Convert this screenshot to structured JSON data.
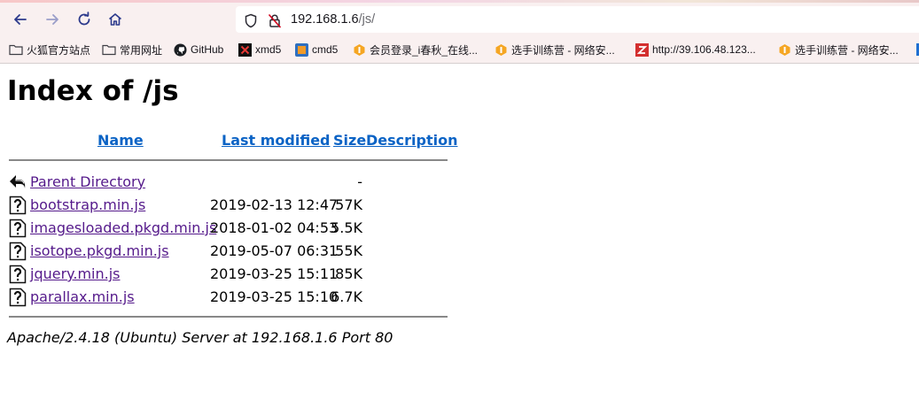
{
  "browser": {
    "url_host": "192.168.1.6",
    "url_path": "/js/"
  },
  "bookmarks": [
    {
      "label": "火狐官方站点",
      "icon": "folder-icon"
    },
    {
      "label": "常用网址",
      "icon": "folder-icon"
    },
    {
      "label": "GitHub",
      "icon": "github-icon"
    },
    {
      "label": "xmd5",
      "icon": "xmd5-icon"
    },
    {
      "label": "cmd5",
      "icon": "cmd5-icon"
    },
    {
      "label": "会员登录_i春秋_在线...",
      "icon": "ichunqiu-icon"
    },
    {
      "label": "选手训练营 - 网络安...",
      "icon": "ichunqiu-icon"
    },
    {
      "label": "http://39.106.48.123...",
      "icon": "z-icon"
    },
    {
      "label": "选手训练营 - 网络安...",
      "icon": "ichunqiu-icon"
    }
  ],
  "page": {
    "title": "Index of /js",
    "columns": {
      "name": "Name",
      "last_modified": "Last modified",
      "size": "Size",
      "description": "Description"
    },
    "rows": [
      {
        "name": "Parent Directory",
        "date": "",
        "size": "-",
        "icon": "back-arrow-icon"
      },
      {
        "name": "bootstrap.min.js",
        "date": "2019-02-13 12:47",
        "size": "57K",
        "icon": "unknown-file-icon"
      },
      {
        "name": "imagesloaded.pkgd.min.js",
        "date": "2018-01-02 04:53",
        "size": "5.5K",
        "icon": "unknown-file-icon"
      },
      {
        "name": "isotope.pkgd.min.js",
        "date": "2019-05-07 06:31",
        "size": "55K",
        "icon": "unknown-file-icon"
      },
      {
        "name": "jquery.min.js",
        "date": "2019-03-25 15:11",
        "size": "85K",
        "icon": "unknown-file-icon"
      },
      {
        "name": "parallax.min.js",
        "date": "2019-03-25 15:10",
        "size": "6.7K",
        "icon": "unknown-file-icon"
      }
    ],
    "footer": "Apache/2.4.18 (Ubuntu) Server at 192.168.1.6 Port 80"
  }
}
